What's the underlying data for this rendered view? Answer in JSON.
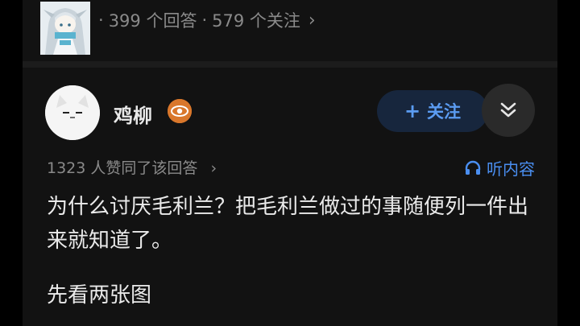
{
  "question": {
    "answers": "399 个回答",
    "follows": "579 个关注",
    "separator": "·",
    "chevron": "›"
  },
  "author": {
    "name": "鸡柳",
    "follow_plus": "+",
    "follow_label": "关注",
    "expand_icon": "double-chevron-down-icon",
    "badge_icon": "eye-badge-icon"
  },
  "meta": {
    "upvotes": "1323 人赞同了该回答",
    "chevron": "›",
    "listen_label": "听内容",
    "listen_icon": "headphones-icon"
  },
  "content": {
    "paragraph1": "为什么讨厌毛利兰？把毛利兰做过的事随便列一件出来就知道了。",
    "paragraph2": "先看两张图"
  },
  "colors": {
    "background": "#121212",
    "accent": "#4a8ef0",
    "badge": "#d9772b",
    "muted_text": "#8a8a8a"
  }
}
